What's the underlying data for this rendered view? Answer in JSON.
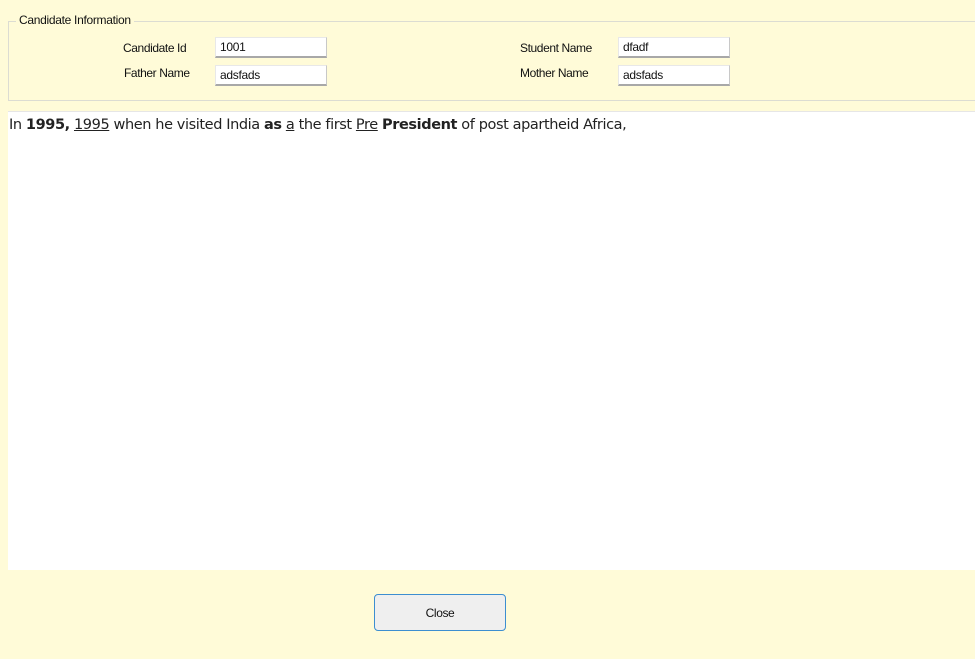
{
  "candidate_info": {
    "title": "Candidate Information",
    "candidate_id_label": "Candidate Id",
    "candidate_id_value": "1001",
    "father_name_label": "Father Name",
    "father_name_value": "adsfads",
    "student_name_label": "Student Name",
    "student_name_value": "dfadf",
    "mother_name_label": "Mother Name",
    "mother_name_value": "adsfads"
  },
  "editor": {
    "segments": [
      {
        "text": "In ",
        "style": "normal"
      },
      {
        "text": "1995,",
        "style": "bold"
      },
      {
        "text": " ",
        "style": "normal"
      },
      {
        "text": "1995",
        "style": "underline"
      },
      {
        "text": " when he visited India ",
        "style": "normal"
      },
      {
        "text": "as",
        "style": "bold"
      },
      {
        "text": " ",
        "style": "normal"
      },
      {
        "text": "a",
        "style": "underline"
      },
      {
        "text": " the first ",
        "style": "normal"
      },
      {
        "text": "Pre",
        "style": "underline"
      },
      {
        "text": " ",
        "style": "normal"
      },
      {
        "text": "President",
        "style": "bold"
      },
      {
        "text": " of post apartheid Africa,",
        "style": "normal"
      }
    ]
  },
  "buttons": {
    "close_label": "Close"
  }
}
